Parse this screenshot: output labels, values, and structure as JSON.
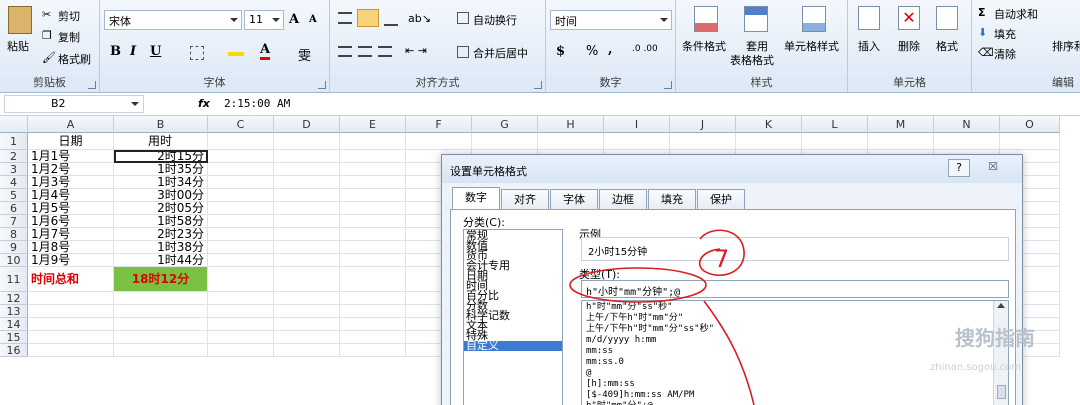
{
  "ribbon": {
    "clipboard": {
      "paste": "粘贴",
      "cut": "剪切",
      "copy": "复制",
      "format_painter": "格式刷",
      "label": "剪贴板"
    },
    "font": {
      "name": "宋体",
      "size": "11",
      "label": "字体",
      "bold": "B",
      "italic": "I",
      "underline": "U",
      "grow": "A",
      "shrink": "A",
      "wen": "雯"
    },
    "alignment": {
      "wrap": "自动换行",
      "merge": "合并后居中",
      "label": "对齐方式"
    },
    "number": {
      "format": "时间",
      "currency": "$",
      "percent": "%",
      "comma": ",",
      "label": "数字"
    },
    "styles": {
      "conditional": "条件格式",
      "table": "套用",
      "table2": "表格格式",
      "cell_styles": "单元格样式",
      "label": "样式"
    },
    "cells": {
      "insert": "插入",
      "delete": "删除",
      "format": "格式",
      "label": "单元格"
    },
    "editing": {
      "autosum": "自动求和",
      "fill": "填充",
      "clear": "清除",
      "sort": "排序和",
      "label": "编辑"
    }
  },
  "formula_bar": {
    "name_box": "B2",
    "fx": "fx",
    "value": "2:15:00 AM"
  },
  "columns": [
    "A",
    "B",
    "C",
    "D",
    "E",
    "F",
    "G",
    "H",
    "I",
    "J",
    "K",
    "L",
    "M",
    "N",
    "O"
  ],
  "rows": [
    "1",
    "2",
    "3",
    "4",
    "5",
    "6",
    "7",
    "8",
    "9",
    "10",
    "11",
    "12",
    "13",
    "14",
    "15",
    "16"
  ],
  "header": {
    "a": "日期",
    "b": "用时"
  },
  "data": [
    {
      "date": "1月1号",
      "time": "2时15分"
    },
    {
      "date": "1月2号",
      "time": "1时35分"
    },
    {
      "date": "1月3号",
      "time": "1时34分"
    },
    {
      "date": "1月4号",
      "time": "3时00分"
    },
    {
      "date": "1月5号",
      "time": "2时05分"
    },
    {
      "date": "1月6号",
      "time": "1时58分"
    },
    {
      "date": "1月7号",
      "time": "2时23分"
    },
    {
      "date": "1月8号",
      "time": "1时38分"
    },
    {
      "date": "1月9号",
      "time": "1时44分"
    }
  ],
  "total": {
    "label": "时间总和",
    "value": "18时12分",
    "label_color": "#e00000",
    "value_bg": "#7ac143",
    "value_color": "#e00000"
  },
  "dialog": {
    "title": "设置单元格格式",
    "help": "?",
    "close": "☒",
    "tabs": [
      "数字",
      "对齐",
      "字体",
      "边框",
      "填充",
      "保护"
    ],
    "category_label": "分类(C):",
    "categories": [
      "常规",
      "数值",
      "货币",
      "会计专用",
      "日期",
      "时间",
      "百分比",
      "分数",
      "科学记数",
      "文本",
      "特殊",
      "自定义"
    ],
    "selected_category": "自定义",
    "sample_label": "示例",
    "sample_value": "2小时15分钟",
    "type_label": "类型(T):",
    "type_value": "h\"小时\"mm\"分钟\";@",
    "formats": [
      "h\"时\"mm\"分\"ss\"秒\"",
      "上午/下午h\"时\"mm\"分\"",
      "上午/下午h\"时\"mm\"分\"ss\"秒\"",
      "m/d/yyyy h:mm",
      "mm:ss",
      "mm:ss.0",
      "@",
      "[h]:mm:ss",
      "[$-409]h:mm:ss AM/PM",
      "h\"时\"mm\"分\";@"
    ],
    "annotation": "7"
  },
  "watermark": {
    "text": "搜狗指南",
    "sub": "zhinan.sogou.com"
  }
}
